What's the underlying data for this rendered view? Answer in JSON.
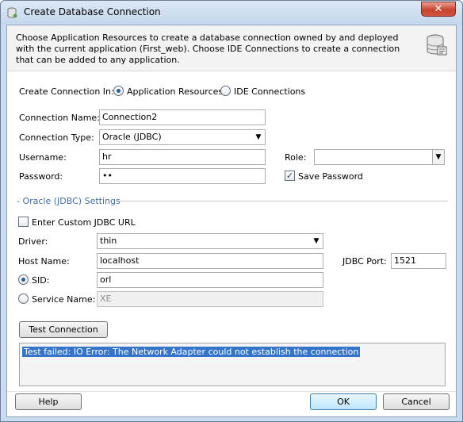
{
  "window": {
    "title": "Create Database Connection",
    "close_glyph": "✕"
  },
  "header": {
    "description": "Choose Application Resources to create a database connection owned by and deployed with the current application (First_web). Choose IDE Connections to create a connection that can be added to any application.",
    "icon": "database-icon"
  },
  "create_in": {
    "label": "Create Connection In:",
    "option_app": "Application Resources",
    "option_ide": "IDE Connections",
    "selected": "Application Resources"
  },
  "form": {
    "connection_name_label": "Connection Name:",
    "connection_name_value": "Connection2",
    "connection_type_label": "Connection Type:",
    "connection_type_value": "Oracle (JDBC)",
    "username_label": "Username:",
    "username_value": "hr",
    "password_label": "Password:",
    "password_value": "••",
    "role_label": "Role:",
    "role_value": "",
    "save_password_label": "Save Password",
    "save_password_checked": true
  },
  "jdbc_settings": {
    "section_title": "- Oracle (JDBC) Settings",
    "custom_url_label": "Enter Custom JDBC URL",
    "custom_url_checked": false,
    "driver_label": "Driver:",
    "driver_value": "thin",
    "host_label": "Host Name:",
    "host_value": "localhost",
    "port_label": "JDBC Port:",
    "port_value": "1521",
    "sid_label": "SID:",
    "sid_value": "orl",
    "service_label": "Service Name:",
    "service_value": "XE",
    "selected_mode": "SID"
  },
  "test": {
    "button_label": "Test Connection",
    "result_message": "Test failed: IO Error: The Network Adapter could not establish the connection"
  },
  "footer": {
    "help_label": "Help",
    "ok_label": "OK",
    "cancel_label": "Cancel"
  },
  "colors": {
    "title_bar": "#c9dcef",
    "close_button": "#c8442e",
    "section_title": "#3e6ea3",
    "selection": "#3475c9"
  }
}
